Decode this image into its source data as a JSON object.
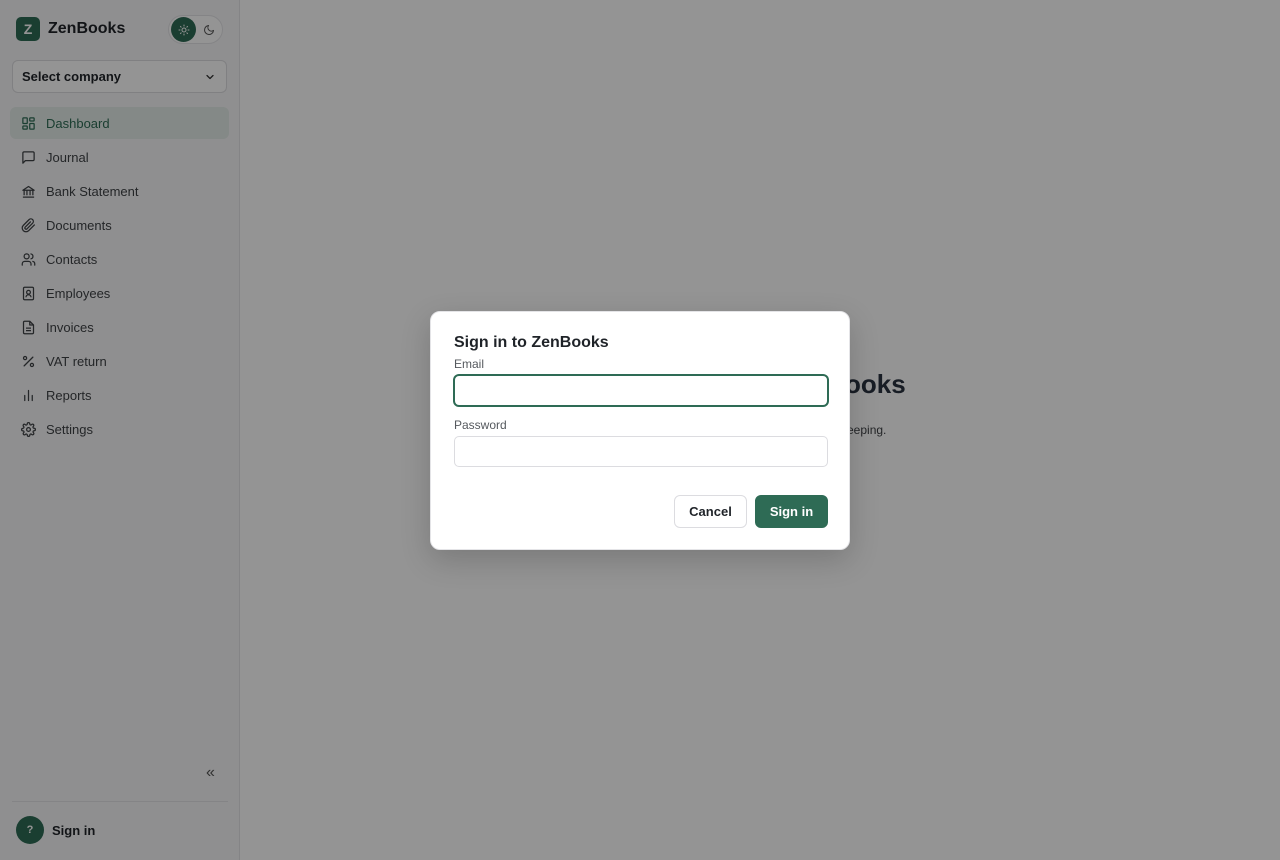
{
  "app": {
    "name": "ZenBooks",
    "logo_letter": "Z",
    "accent_color": "#2e6b55"
  },
  "sidebar": {
    "company_select": {
      "value": "Select company"
    },
    "theme_toggle": {
      "options": [
        "sun-icon",
        "moon-icon"
      ],
      "active": "light"
    },
    "items": [
      {
        "label": "Dashboard",
        "icon": "dashboard-icon",
        "active": true
      },
      {
        "label": "Journal",
        "icon": "message-square-icon"
      },
      {
        "label": "Bank Statement",
        "icon": "bank-icon"
      },
      {
        "label": "Documents",
        "icon": "paperclip-icon"
      },
      {
        "label": "Contacts",
        "icon": "users-icon"
      },
      {
        "label": "Employees",
        "icon": "badge-icon"
      },
      {
        "label": "Invoices",
        "icon": "file-text-icon"
      },
      {
        "label": "VAT return",
        "icon": "percent-icon"
      },
      {
        "label": "Reports",
        "icon": "bar-chart-icon"
      },
      {
        "label": "Settings",
        "icon": "gear-icon"
      }
    ],
    "collapse_label": "«",
    "user": {
      "avatar_text": "?",
      "label": "Sign in"
    }
  },
  "main": {
    "welcome_title_visible": "ooks",
    "welcome_subtitle_visible": "eeping."
  },
  "dialog": {
    "title": "Sign in to ZenBooks",
    "email_label": "Email",
    "email_value": "",
    "password_label": "Password",
    "password_value": "",
    "cancel_label": "Cancel",
    "submit_label": "Sign in"
  }
}
